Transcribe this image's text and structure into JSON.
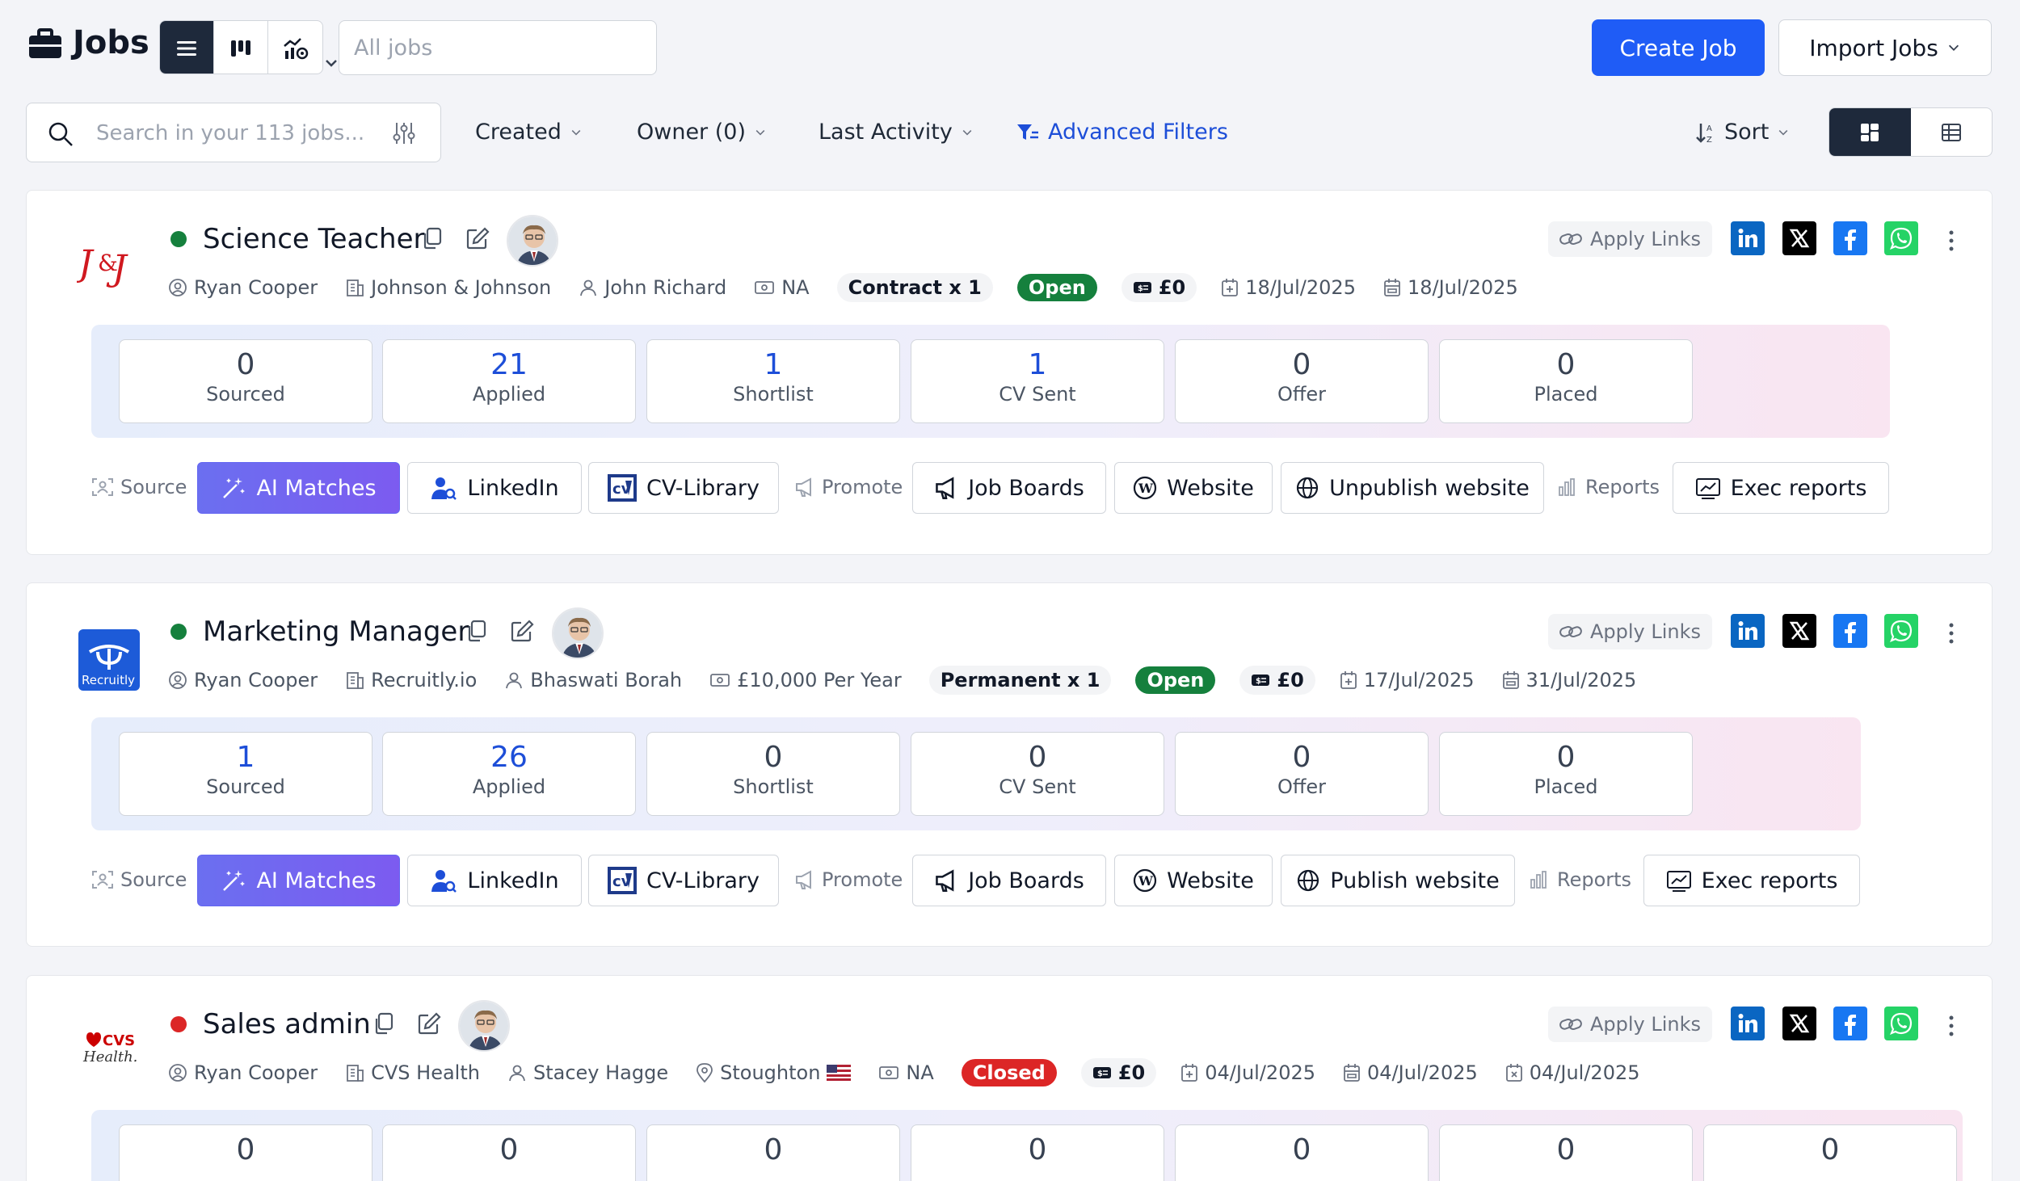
{
  "header": {
    "title": "Jobs",
    "view_modes": [
      "list-icon",
      "kanban-icon",
      "analytics-icon"
    ],
    "job_filter_placeholder": "All jobs",
    "create_label": "Create Job",
    "import_label": "Import Jobs"
  },
  "toolbar": {
    "search_placeholder": "Search in your 113 jobs...",
    "created": "Created",
    "owner": "Owner (0)",
    "last_activity": "Last Activity",
    "advanced_filters": "Advanced Filters",
    "sort": "Sort"
  },
  "labels": {
    "apply_links": "Apply Links",
    "source": "Source",
    "promote": "Promote",
    "reports": "Reports",
    "ai_matches": "AI Matches",
    "linkedin": "LinkedIn",
    "cv_library": "CV-Library",
    "job_boards": "Job Boards",
    "website": "Website",
    "exec_reports": "Exec reports"
  },
  "colors": {
    "accent": "#1f5cf6",
    "open": "#15803d",
    "closed": "#dc2626",
    "status_green": "#15803d",
    "status_red": "#dc2626"
  },
  "jobs": [
    {
      "title": "Science Teacher",
      "logo": "J&J",
      "status_dot": "green",
      "owner": "Ryan Cooper",
      "company": "Johnson & Johnson",
      "contact": "John Richard",
      "salary_text": "NA",
      "type": "Contract x 1",
      "status": "Open",
      "fee": "£0",
      "dates": [
        "18/Jul/2025",
        "18/Jul/2025"
      ],
      "stats": [
        {
          "value": "0",
          "label": "Sourced"
        },
        {
          "value": "21",
          "label": "Applied"
        },
        {
          "value": "1",
          "label": "Shortlist"
        },
        {
          "value": "1",
          "label": "CV Sent"
        },
        {
          "value": "0",
          "label": "Offer"
        },
        {
          "value": "0",
          "label": "Placed"
        }
      ],
      "website_action": "Unpublish website"
    },
    {
      "title": "Marketing Manager",
      "logo": "Recruitly",
      "status_dot": "green",
      "owner": "Ryan Cooper",
      "company": "Recruitly.io",
      "contact": "Bhaswati Borah",
      "salary_text": "£10,000 Per Year",
      "type": "Permanent x 1",
      "status": "Open",
      "fee": "£0",
      "dates": [
        "17/Jul/2025",
        "31/Jul/2025"
      ],
      "stats": [
        {
          "value": "1",
          "label": "Sourced"
        },
        {
          "value": "26",
          "label": "Applied"
        },
        {
          "value": "0",
          "label": "Shortlist"
        },
        {
          "value": "0",
          "label": "CV Sent"
        },
        {
          "value": "0",
          "label": "Offer"
        },
        {
          "value": "0",
          "label": "Placed"
        }
      ],
      "website_action": "Publish website"
    },
    {
      "title": "Sales admin",
      "logo": "CVS Health",
      "status_dot": "red",
      "owner": "Ryan Cooper",
      "company": "CVS Health",
      "contact": "Stacey Hagge",
      "location": "Stoughton",
      "salary_text": "NA",
      "status": "Closed",
      "fee": "£0",
      "dates": [
        "04/Jul/2025",
        "04/Jul/2025",
        "04/Jul/2025"
      ],
      "stats": [
        {
          "value": "0"
        },
        {
          "value": "0"
        },
        {
          "value": "0"
        },
        {
          "value": "0"
        },
        {
          "value": "0"
        },
        {
          "value": "0"
        },
        {
          "value": "0"
        }
      ]
    }
  ]
}
